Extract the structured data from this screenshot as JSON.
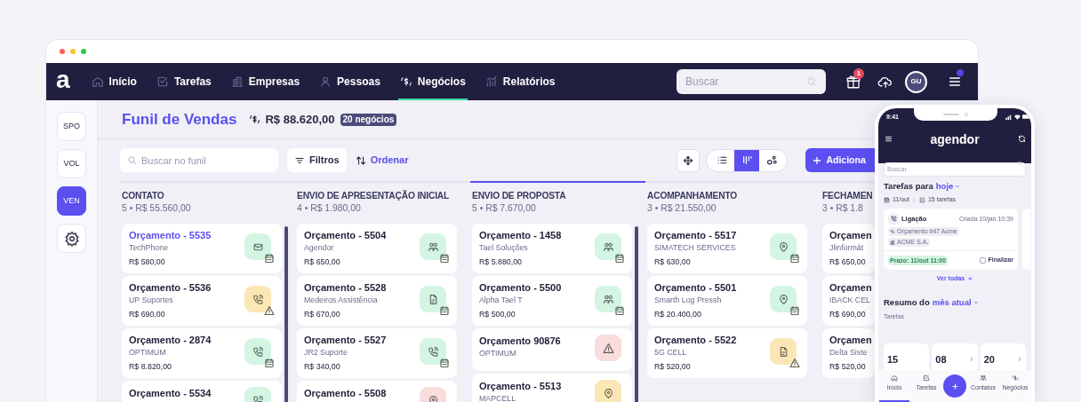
{
  "nav": {
    "logo": "a",
    "items": [
      {
        "label": "Início",
        "kind": "home",
        "selected": false
      },
      {
        "label": "Tarefas",
        "kind": "check",
        "selected": false
      },
      {
        "label": "Empresas",
        "kind": "building",
        "selected": false
      },
      {
        "label": "Pessoas",
        "kind": "person",
        "selected": false
      },
      {
        "label": "Negócios",
        "kind": "dollar",
        "selected": true
      },
      {
        "label": "Relatórios",
        "kind": "chart",
        "selected": false
      }
    ],
    "search": {
      "placeholder": "Buscar"
    },
    "notifications": "1",
    "avatar": "GU",
    "menu_alert": true
  },
  "sidebar": {
    "items": [
      {
        "label": "SPO",
        "selected": false
      },
      {
        "label": "VOL",
        "selected": false
      },
      {
        "label": "VEN",
        "selected": true
      }
    ]
  },
  "header": {
    "title": "Funil de Vendas",
    "total": "R$ 88.620,00",
    "count": "20 negócios"
  },
  "toolbar": {
    "search": {
      "placeholder": "Buscar no funil"
    },
    "filters": "Filtros",
    "sort": "Ordenar",
    "views": [
      {
        "kind": "list",
        "selected": false
      },
      {
        "kind": "kanban",
        "selected": true
      },
      {
        "kind": "scatter",
        "selected": false
      }
    ],
    "add": "Adiciona"
  },
  "board": {
    "columns": [
      {
        "title": "CONTATO",
        "summary": "5 • R$ 55.560,00",
        "selected": false,
        "scrollable": true,
        "cards": [
          {
            "title": "Orçamento - 5535",
            "company": "TechPhone",
            "value": "R$ 580,00",
            "selected": true,
            "kind": "email",
            "color": "#d3f5e2",
            "alert": false
          },
          {
            "title": "Orçamento - 5536",
            "company": "UP Suportes",
            "value": "R$ 690,00",
            "selected": false,
            "kind": "call",
            "color": "#fbe7b5",
            "alert": true
          },
          {
            "title": "Orçamento - 2874",
            "company": "OPTIMUM",
            "value": "R$ 8.820,00",
            "selected": false,
            "kind": "call",
            "color": "#d3f5e2",
            "alert": false
          },
          {
            "title": "Orçamento - 5534",
            "selected": false,
            "kind": "call",
            "color": "#d3f5e2"
          }
        ]
      },
      {
        "title": "ENVIO DE APRESENTAÇÃO INICIAL",
        "summary": "4 • R$ 1.980,00",
        "selected": false,
        "scrollable": false,
        "cards": [
          {
            "title": "Orçamento - 5504",
            "company": "Agendor",
            "value": "R$ 650,00",
            "selected": false,
            "kind": "meeting",
            "color": "#d3f5e2",
            "alert": false
          },
          {
            "title": "Orçamento - 5528",
            "company": "Medeiros Assistência",
            "value": "R$ 670,00",
            "selected": false,
            "kind": "document",
            "color": "#d3f5e2",
            "alert": false
          },
          {
            "title": "Orçamento - 5527",
            "company": "JR2 Suporte",
            "value": "R$ 340,00",
            "selected": false,
            "kind": "call",
            "color": "#d3f5e2",
            "alert": false
          },
          {
            "title": "Orçamento - 5508",
            "selected": false,
            "kind": "location",
            "color": "#f9dcdc"
          }
        ]
      },
      {
        "title": "ENVIO DE PROPOSTA",
        "summary": "5 • R$ 7.670,00",
        "selected": true,
        "scrollable": true,
        "cards": [
          {
            "title": "Orçamento - 1458",
            "company": "Tael Soluções",
            "value": "R$ 5.880,00",
            "selected": false,
            "kind": "meeting",
            "color": "#d3f5e2",
            "alert": false
          },
          {
            "title": "Orçamento - 5500",
            "company": "Alpha Tael T",
            "value": "R$ 500,00",
            "selected": false,
            "kind": "meeting",
            "color": "#d3f5e2",
            "alert": false
          },
          {
            "title": "Orçamento 90876",
            "company": "OPTIMUM",
            "selected": false,
            "kind": "alert",
            "color": "#f9dcdc"
          },
          {
            "title": "Orçamento - 5513",
            "company": "MAPCELL",
            "selected": false,
            "kind": "location",
            "color": "#fbe7b5"
          }
        ]
      },
      {
        "title": "ACOMPANHAMENTO",
        "summary": "3 • R$ 21.550,00",
        "selected": false,
        "scrollable": false,
        "cards": [
          {
            "title": "Orçamento - 5517",
            "company": "SIMATECH SERVICES",
            "value": "R$ 630,00",
            "selected": false,
            "kind": "location",
            "color": "#d3f5e2",
            "alert": false
          },
          {
            "title": "Orçamento - 5501",
            "company": "Smarth Log Pressh",
            "value": "R$ 20.400,00",
            "selected": false,
            "kind": "location",
            "color": "#d3f5e2",
            "alert": false
          },
          {
            "title": "Orçamento - 5522",
            "company": "5G CELL",
            "value": "R$ 520,00",
            "selected": false,
            "kind": "document",
            "color": "#fbe7b5",
            "alert": true
          }
        ]
      },
      {
        "title": "FECHAMEN",
        "summary": "3 • R$ 1.8",
        "selected": false,
        "scrollable": false,
        "cards": [
          {
            "title": "Orçamen",
            "company": "Jlinformát",
            "value": "R$ 650,00",
            "selected": false
          },
          {
            "title": "Orçamen",
            "company": "IBACK CEL",
            "value": "R$ 690,00",
            "selected": false
          },
          {
            "title": "Orçamen",
            "company": "Delta Siste",
            "value": "R$ 520,00",
            "selected": false
          }
        ]
      }
    ]
  },
  "phone": {
    "time": "9:41",
    "brand": "agendor",
    "search": {
      "placeholder": "Buscar"
    },
    "tasks_title": "Tarefas para",
    "tasks_period": "hoje",
    "date": "11/out",
    "task_count": "15 tarefas",
    "task": {
      "type": "Ligação",
      "created": "Criada 10/jan 10:39",
      "deal": "Orçamento #47 Acme",
      "company": "ACME S.A.",
      "deadline": "Prazo: 11/out 11:00",
      "done_label": "Finalizar",
      "done": false
    },
    "see_all": "Ver todas",
    "summary_title": "Resumo do",
    "summary_period": "mês atual",
    "summary_label": "Tarefas",
    "stats": [
      {
        "value": "15",
        "arrow": false
      },
      {
        "value": "08",
        "arrow": true
      },
      {
        "value": "20",
        "arrow": true
      }
    ],
    "tabs": [
      {
        "label": "Início",
        "kind": "home",
        "selected": true
      },
      {
        "label": "Tarefas",
        "kind": "check",
        "selected": false
      },
      {
        "label": "Contatos",
        "kind": "meeting",
        "selected": false
      },
      {
        "label": "Negócios",
        "kind": "dollar",
        "selected": false
      }
    ]
  }
}
